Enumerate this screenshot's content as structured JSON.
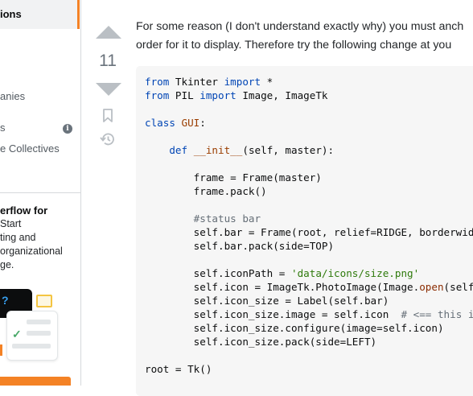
{
  "sidebar": {
    "active_item": "ions",
    "items": [
      "anies",
      "s",
      "e Collectives"
    ],
    "info_icon": "i",
    "promo": {
      "title": "erflow for",
      "lines": [
        "Start",
        "ting and",
        "organizational",
        "ge."
      ],
      "badge": "?"
    }
  },
  "post": {
    "score": "11",
    "answer_lines": [
      "For some reason (I don't understand exactly why) you must anch",
      "order for it to display. Therefore try the following change at you"
    ],
    "code_lines": [
      "from Tkinter import *",
      "from PIL import Image, ImageTk",
      "",
      "class GUI:",
      "",
      "    def __init__(self, master):",
      "",
      "        frame = Frame(master)",
      "        frame.pack()",
      "",
      "        #status bar",
      "        self.bar = Frame(root, relief=RIDGE, borderwid",
      "        self.bar.pack(side=TOP)",
      "",
      "        self.iconPath = 'data/icons/size.png'",
      "        self.icon = ImageTk.PhotoImage(Image.open(self",
      "        self.icon_size = Label(self.bar)",
      "        self.icon_size.image = self.icon  # <== this i",
      "        self.icon_size.configure(image=self.icon)",
      "        self.icon_size.pack(side=LEFT)",
      "",
      "root = Tk()"
    ]
  },
  "colors": {
    "accent": "#f48225",
    "vote_arrow": "#babfc4",
    "code_bg": "#f6f6f6",
    "keyword": "#0045b5"
  },
  "icons": [
    "up-arrow-icon",
    "down-arrow-icon",
    "bookmark-icon",
    "history-icon",
    "info-icon",
    "chat-icon",
    "check-icon"
  ]
}
